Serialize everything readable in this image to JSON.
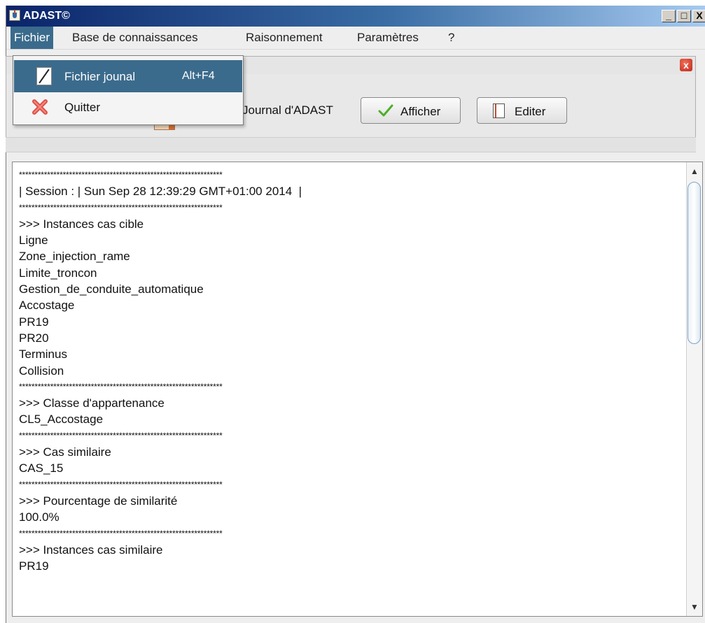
{
  "window": {
    "title": "ADAST©"
  },
  "titlebar_buttons": {
    "minimize": "_",
    "maximize": "□",
    "close": "X"
  },
  "menubar": {
    "items": [
      {
        "label": "Fichier",
        "active": true
      },
      {
        "label": "Base de connaissances"
      },
      {
        "label": "Raisonnement"
      },
      {
        "label": "Paramètres"
      },
      {
        "label": "?"
      }
    ]
  },
  "dropdown": {
    "items": [
      {
        "label": "Fichier jounal",
        "accelerator": "Alt+F4",
        "icon": "pencil-icon",
        "selected": true
      },
      {
        "label": "Quitter",
        "icon": "red-x-icon"
      }
    ]
  },
  "internal_frame": {
    "close": "x"
  },
  "toolbar": {
    "journal_label": "Journal d'ADAST",
    "afficher_label": "Afficher",
    "editer_label": "Editer"
  },
  "log": {
    "lines": [
      {
        "text": "*****************************************************************",
        "stars": true
      },
      {
        "text": "| Session : | Sun Sep 28 12:39:29 GMT+01:00 2014  |"
      },
      {
        "text": "*****************************************************************",
        "stars": true
      },
      {
        "text": ">>> Instances cas cible"
      },
      {
        "text": "Ligne"
      },
      {
        "text": "Zone_injection_rame"
      },
      {
        "text": "Limite_troncon"
      },
      {
        "text": "Gestion_de_conduite_automatique"
      },
      {
        "text": "Accostage"
      },
      {
        "text": "PR19"
      },
      {
        "text": "PR20"
      },
      {
        "text": "Terminus"
      },
      {
        "text": "Collision"
      },
      {
        "text": "*****************************************************************",
        "stars": true
      },
      {
        "text": ">>> Classe d'appartenance"
      },
      {
        "text": "CL5_Accostage"
      },
      {
        "text": "*****************************************************************",
        "stars": true
      },
      {
        "text": ">>> Cas similaire"
      },
      {
        "text": "CAS_15"
      },
      {
        "text": "*****************************************************************",
        "stars": true
      },
      {
        "text": ">>> Pourcentage de similarité"
      },
      {
        "text": "100.0%"
      },
      {
        "text": "*****************************************************************",
        "stars": true
      },
      {
        "text": ">>> Instances cas similaire"
      },
      {
        "text": "PR19"
      }
    ]
  },
  "scrollbar": {
    "up": "▲",
    "down": "▼"
  },
  "colors": {
    "menu_highlight": "#3b6b8c",
    "titlebar": "#0a246a"
  }
}
